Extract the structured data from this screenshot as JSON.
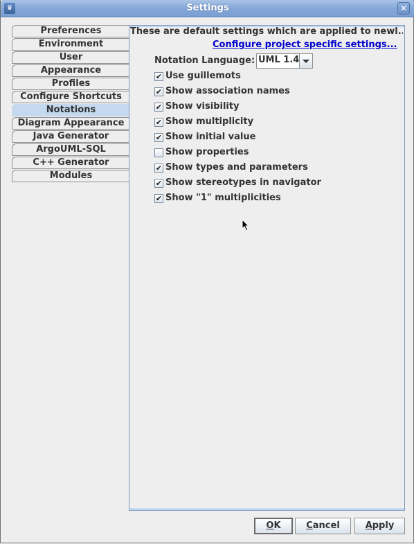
{
  "window": {
    "title": "Settings",
    "app_icon": "argouml-icon",
    "close_icon": "close-icon"
  },
  "tabs": [
    {
      "label": "Preferences",
      "selected": false
    },
    {
      "label": "Environment",
      "selected": false
    },
    {
      "label": "User",
      "selected": false
    },
    {
      "label": "Appearance",
      "selected": false
    },
    {
      "label": "Profiles",
      "selected": false
    },
    {
      "label": "Configure Shortcuts",
      "selected": false
    },
    {
      "label": "Notations",
      "selected": true
    },
    {
      "label": "Diagram Appearance",
      "selected": false
    },
    {
      "label": "Java Generator",
      "selected": false
    },
    {
      "label": "ArgoUML-SQL",
      "selected": false
    },
    {
      "label": "C++ Generator",
      "selected": false
    },
    {
      "label": "Modules",
      "selected": false
    }
  ],
  "panel": {
    "description": "These are default settings which are applied to newl...",
    "project_link": "Configure project specific settings...",
    "notation_language_label": "Notation Language:",
    "notation_language_value": "UML 1.4",
    "options": [
      {
        "label": "Use guillemots",
        "checked": true
      },
      {
        "label": "Show association names",
        "checked": true
      },
      {
        "label": "Show visibility",
        "checked": true
      },
      {
        "label": "Show multiplicity",
        "checked": true
      },
      {
        "label": "Show initial value",
        "checked": true
      },
      {
        "label": "Show properties",
        "checked": false
      },
      {
        "label": "Show types and parameters",
        "checked": true
      },
      {
        "label": "Show stereotypes in navigator",
        "checked": true
      },
      {
        "label": "Show \"1\" multiplicities",
        "checked": true
      }
    ]
  },
  "buttons": {
    "ok": {
      "mnemonic": "O",
      "rest": "K"
    },
    "cancel": {
      "mnemonic": "C",
      "rest": "ancel"
    },
    "apply": {
      "mnemonic": "A",
      "rest": "pply"
    }
  }
}
